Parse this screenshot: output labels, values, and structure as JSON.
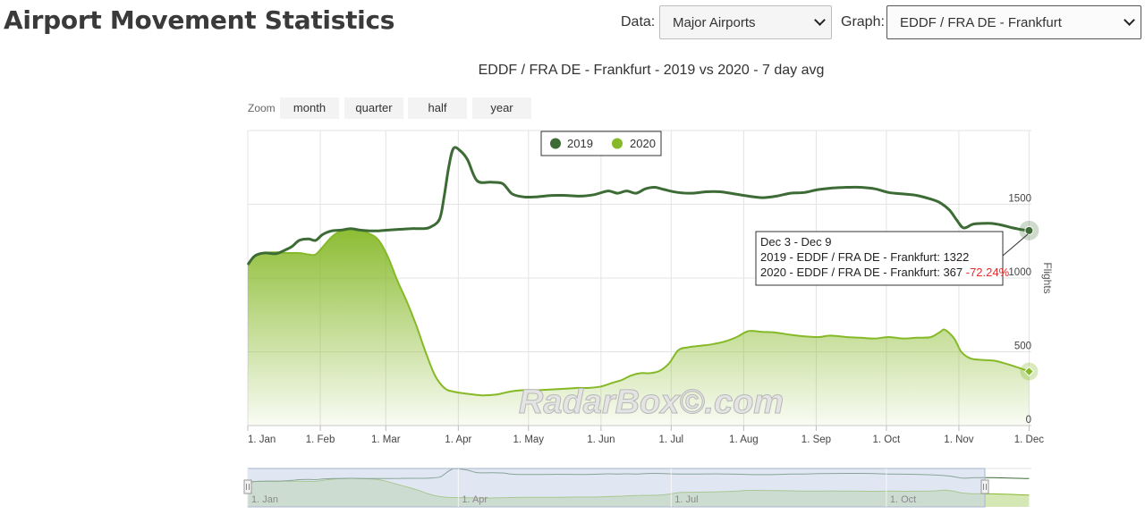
{
  "header": {
    "title": "Airport Movement Statistics",
    "data_label": "Data:",
    "data_value": "Major Airports",
    "graph_label": "Graph:",
    "graph_value": "EDDF / FRA DE - Frankfurt"
  },
  "zoom": {
    "label": "Zoom",
    "buttons": [
      "month",
      "quarter",
      "half",
      "year"
    ]
  },
  "watermark": "RadarBox©.com",
  "tooltip": {
    "title": "Dec 3 - Dec 9",
    "line1": "2019 - EDDF / FRA DE - Frankfurt: 1322",
    "line2_prefix": "2020 - EDDF / FRA DE - Frankfurt: 367 ",
    "line2_change": "-72.24%"
  },
  "colors": {
    "series_2019": "#3d6b35",
    "series_2020": "#86b928",
    "negative": "#e52b2b",
    "navigator_mask": "#c7d4ea"
  },
  "navigator_labels": [
    "1. Jan",
    "1. Apr",
    "1. Jul",
    "1. Oct"
  ],
  "chart_data": {
    "type": "area",
    "title": "EDDF / FRA DE - Frankfurt - 2019 vs 2020 - 7 day avg",
    "ylabel": "Flights",
    "ylim": [
      0,
      2000
    ],
    "yticks": [
      0,
      500,
      1000,
      1500
    ],
    "xlim": [
      0,
      335
    ],
    "xticks": [
      {
        "day": 0,
        "label": "1. Jan"
      },
      {
        "day": 31,
        "label": "1. Feb"
      },
      {
        "day": 59,
        "label": "1. Mar"
      },
      {
        "day": 90,
        "label": "1. Apr"
      },
      {
        "day": 120,
        "label": "1. May"
      },
      {
        "day": 151,
        "label": "1. Jun"
      },
      {
        "day": 181,
        "label": "1. Jul"
      },
      {
        "day": 212,
        "label": "1. Aug"
      },
      {
        "day": 243,
        "label": "1. Sep"
      },
      {
        "day": 273,
        "label": "1. Oct"
      },
      {
        "day": 304,
        "label": "1. Nov"
      },
      {
        "day": 334,
        "label": "1. Dec"
      }
    ],
    "legend": {
      "placement": "top-center"
    },
    "series": [
      {
        "name": "2019",
        "type": "line",
        "points": [
          [
            0,
            1090
          ],
          [
            3,
            1150
          ],
          [
            7,
            1170
          ],
          [
            12,
            1165
          ],
          [
            16,
            1190
          ],
          [
            19,
            1215
          ],
          [
            22,
            1255
          ],
          [
            26,
            1265
          ],
          [
            29,
            1255
          ],
          [
            32,
            1295
          ],
          [
            36,
            1320
          ],
          [
            40,
            1325
          ],
          [
            44,
            1335
          ],
          [
            48,
            1325
          ],
          [
            52,
            1320
          ],
          [
            56,
            1320
          ],
          [
            60,
            1325
          ],
          [
            65,
            1330
          ],
          [
            70,
            1335
          ],
          [
            75,
            1335
          ],
          [
            78,
            1345
          ],
          [
            82,
            1400
          ],
          [
            84,
            1560
          ],
          [
            86,
            1760
          ],
          [
            88,
            1880
          ],
          [
            91,
            1860
          ],
          [
            94,
            1800
          ],
          [
            98,
            1660
          ],
          [
            104,
            1650
          ],
          [
            109,
            1640
          ],
          [
            113,
            1570
          ],
          [
            118,
            1550
          ],
          [
            123,
            1550
          ],
          [
            130,
            1560
          ],
          [
            136,
            1560
          ],
          [
            142,
            1555
          ],
          [
            148,
            1565
          ],
          [
            154,
            1590
          ],
          [
            158,
            1575
          ],
          [
            162,
            1590
          ],
          [
            166,
            1575
          ],
          [
            170,
            1605
          ],
          [
            174,
            1615
          ],
          [
            178,
            1600
          ],
          [
            184,
            1580
          ],
          [
            190,
            1575
          ],
          [
            196,
            1585
          ],
          [
            202,
            1585
          ],
          [
            208,
            1570
          ],
          [
            214,
            1555
          ],
          [
            220,
            1545
          ],
          [
            226,
            1555
          ],
          [
            232,
            1575
          ],
          [
            238,
            1580
          ],
          [
            244,
            1600
          ],
          [
            250,
            1610
          ],
          [
            256,
            1615
          ],
          [
            262,
            1615
          ],
          [
            268,
            1605
          ],
          [
            274,
            1580
          ],
          [
            280,
            1570
          ],
          [
            286,
            1560
          ],
          [
            292,
            1535
          ],
          [
            296,
            1510
          ],
          [
            300,
            1460
          ],
          [
            303,
            1395
          ],
          [
            306,
            1340
          ],
          [
            310,
            1365
          ],
          [
            314,
            1370
          ],
          [
            318,
            1370
          ],
          [
            322,
            1360
          ],
          [
            327,
            1340
          ],
          [
            332,
            1325
          ],
          [
            334,
            1322
          ]
        ]
      },
      {
        "name": "2020",
        "type": "area",
        "points": [
          [
            0,
            1090
          ],
          [
            3,
            1150
          ],
          [
            7,
            1170
          ],
          [
            12,
            1175
          ],
          [
            17,
            1170
          ],
          [
            22,
            1170
          ],
          [
            26,
            1160
          ],
          [
            29,
            1160
          ],
          [
            32,
            1210
          ],
          [
            36,
            1280
          ],
          [
            40,
            1320
          ],
          [
            45,
            1335
          ],
          [
            52,
            1300
          ],
          [
            56,
            1255
          ],
          [
            60,
            1140
          ],
          [
            64,
            980
          ],
          [
            68,
            840
          ],
          [
            72,
            680
          ],
          [
            76,
            500
          ],
          [
            80,
            340
          ],
          [
            84,
            255
          ],
          [
            88,
            230
          ],
          [
            94,
            215
          ],
          [
            100,
            205
          ],
          [
            106,
            210
          ],
          [
            112,
            230
          ],
          [
            118,
            240
          ],
          [
            124,
            240
          ],
          [
            130,
            245
          ],
          [
            136,
            250
          ],
          [
            141,
            255
          ],
          [
            146,
            255
          ],
          [
            151,
            265
          ],
          [
            156,
            290
          ],
          [
            160,
            310
          ],
          [
            164,
            340
          ],
          [
            168,
            355
          ],
          [
            172,
            355
          ],
          [
            176,
            370
          ],
          [
            180,
            420
          ],
          [
            184,
            510
          ],
          [
            188,
            530
          ],
          [
            193,
            540
          ],
          [
            198,
            550
          ],
          [
            204,
            570
          ],
          [
            209,
            600
          ],
          [
            214,
            640
          ],
          [
            220,
            635
          ],
          [
            226,
            630
          ],
          [
            232,
            615
          ],
          [
            238,
            605
          ],
          [
            244,
            600
          ],
          [
            249,
            610
          ],
          [
            256,
            600
          ],
          [
            262,
            595
          ],
          [
            268,
            590
          ],
          [
            274,
            600
          ],
          [
            280,
            590
          ],
          [
            286,
            595
          ],
          [
            292,
            600
          ],
          [
            296,
            635
          ],
          [
            298,
            650
          ],
          [
            302,
            590
          ],
          [
            305,
            500
          ],
          [
            309,
            455
          ],
          [
            314,
            445
          ],
          [
            319,
            440
          ],
          [
            324,
            420
          ],
          [
            329,
            395
          ],
          [
            334,
            367
          ]
        ]
      }
    ],
    "tooltip_point": {
      "day": 334,
      "value_2019": 1322,
      "value_2020": 367
    }
  }
}
